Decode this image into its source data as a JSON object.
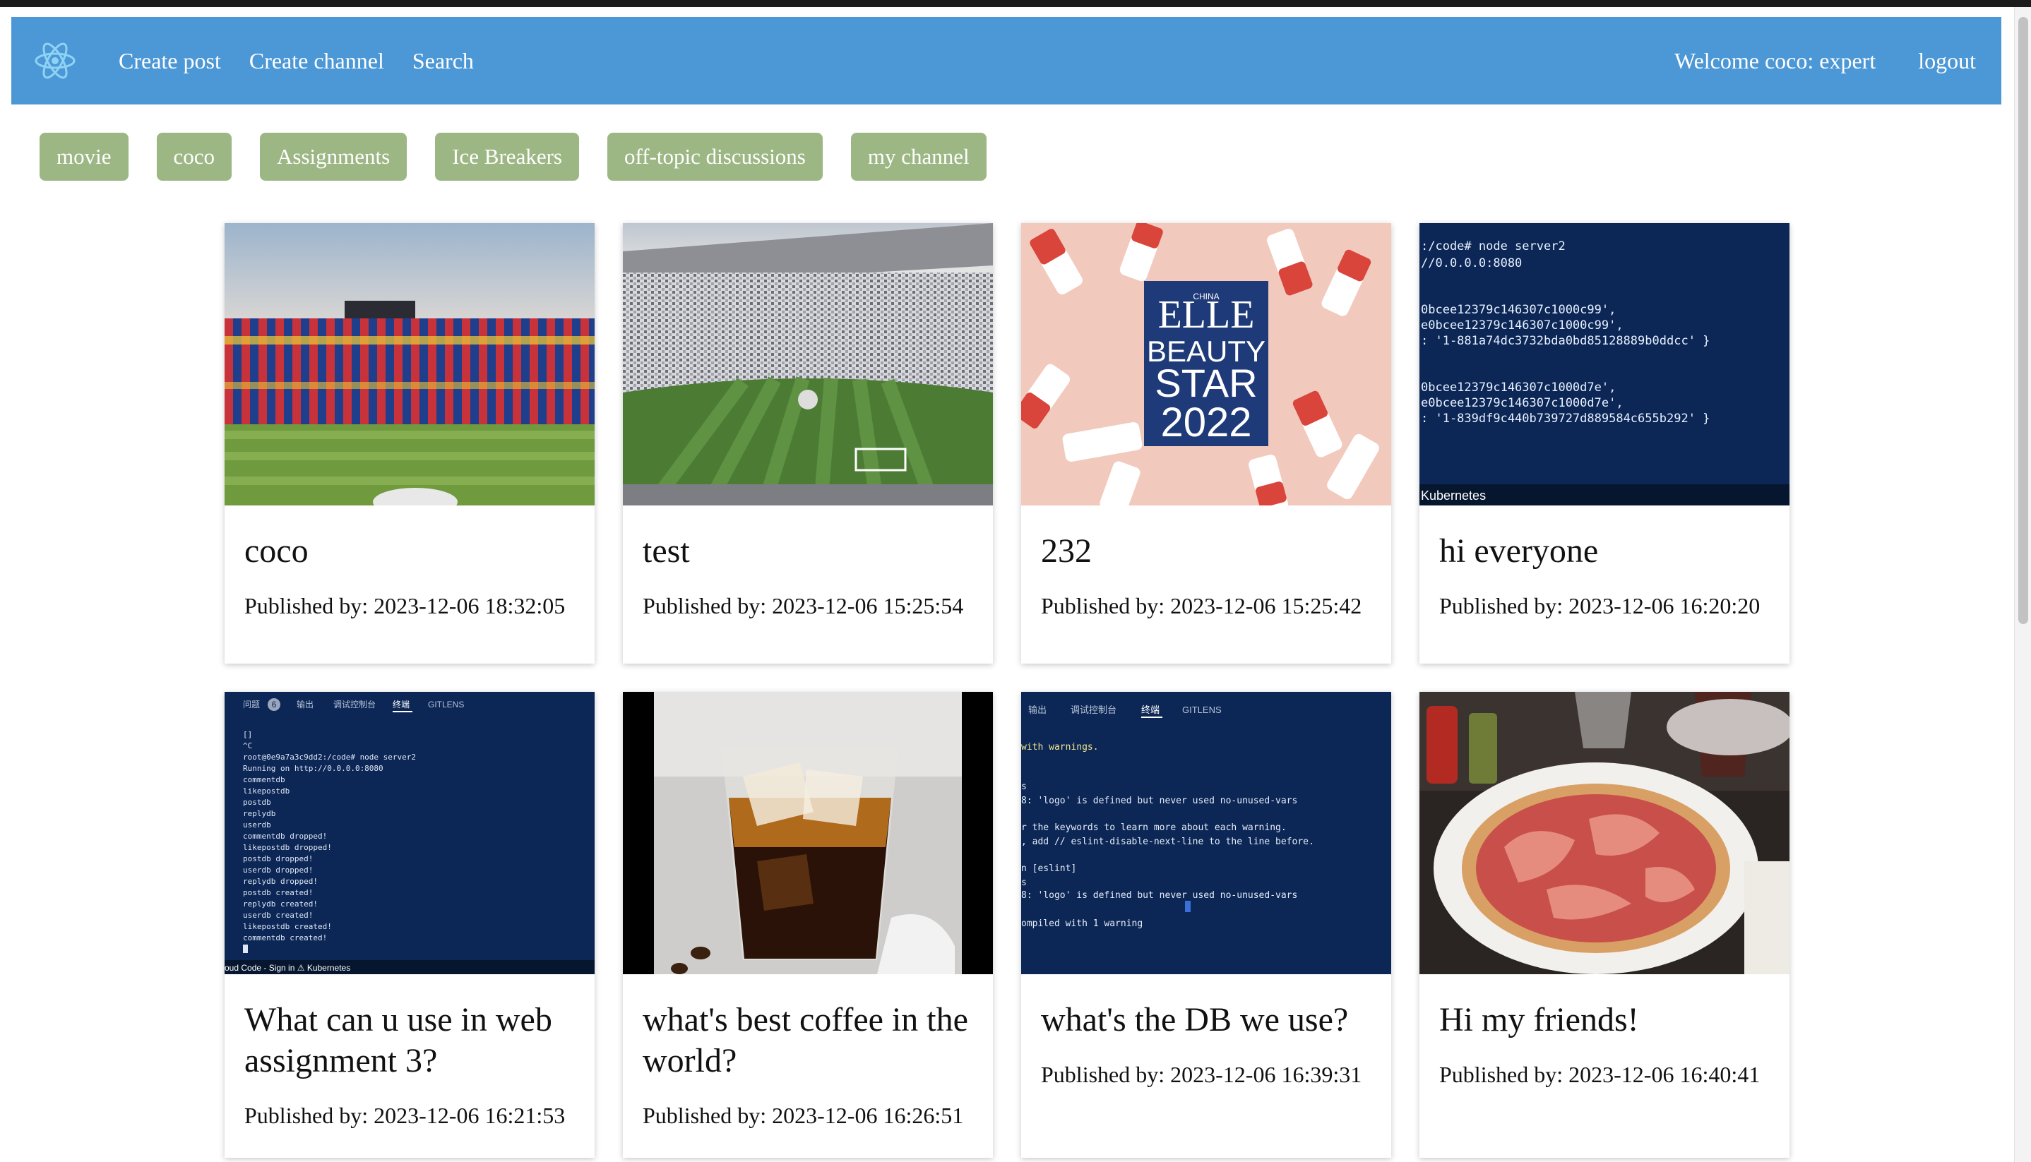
{
  "nav": {
    "links": [
      "Create post",
      "Create channel",
      "Search"
    ],
    "welcome": "Welcome coco: expert",
    "logout": "logout"
  },
  "channels": [
    "movie",
    "coco",
    "Assignments",
    "Ice Breakers",
    "off-topic discussions",
    "my channel"
  ],
  "posts": [
    {
      "title": "coco",
      "published": "Published by: 2023-12-06 18:32:05"
    },
    {
      "title": "test",
      "published": "Published by: 2023-12-06 15:25:54"
    },
    {
      "title": "232",
      "published": "Published by: 2023-12-06 15:25:42"
    },
    {
      "title": "hi everyone",
      "published": "Published by: 2023-12-06 16:20:20"
    },
    {
      "title": "What can u use in web assignment 3?",
      "published": "Published by: 2023-12-06 16:21:53"
    },
    {
      "title": "what's best coffee in the world?",
      "published": "Published by: 2023-12-06 16:26:51"
    },
    {
      "title": "what's the DB we use?",
      "published": "Published by: 2023-12-06 16:39:31"
    },
    {
      "title": "Hi my friends!",
      "published": "Published by: 2023-12-06 16:40:41"
    }
  ],
  "thumb_text": {
    "elle": {
      "brand": "ELLE",
      "line1": "BEAUTY",
      "line2": "STAR",
      "year": "2022",
      "china": "CHINA"
    },
    "terminal1": {
      "lines": [
        ":/code# node server2",
        "//0.0.0.0:8080",
        "0bcee12379c146307c1000c99',",
        "e0bcee12379c146307c1000c99',",
        ": '1-881a74dc3732bda0bd85128889b0ddcc' }",
        "0bcee12379c146307c1000d7e',",
        "e0bcee12379c146307c1000d7e',",
        ": '1-839df9c440b739727d889584c655b292' }"
      ],
      "footer": "Kubernetes"
    },
    "terminal2": {
      "tabs": [
        "问题",
        "输出",
        "调试控制台",
        "终端",
        "GITLENS"
      ],
      "badge": "6",
      "lines": [
        "[]",
        "^C",
        "root@0e9a7a3c9dd2:/code# node server2",
        "Running on http://0.0.0.0:8080",
        "commentdb",
        "likepostdb",
        "postdb",
        "replydb",
        "userdb",
        "commentdb dropped!",
        "likepostdb dropped!",
        "postdb dropped!",
        "userdb dropped!",
        "replydb dropped!",
        "postdb created!",
        "replydb created!",
        "userdb created!",
        "likepostdb created!",
        "commentdb created!"
      ],
      "footer": "oud Code - Sign in    ⚠ Kubernetes"
    },
    "terminal3": {
      "tabs": [
        "输出",
        "调试控制台",
        "终端",
        "GITLENS"
      ],
      "lines": [
        "with warnings.",
        "",
        "s",
        "8:  'logo' is defined but never used  no-unused-vars",
        "",
        "r the keywords to learn more about each warning.",
        ", add // eslint-disable-next-line to the line before.",
        "",
        "n [eslint]",
        "s",
        "8:  'logo' is defined but never used  no-unused-vars",
        "",
        "ompiled with 1 warning"
      ]
    }
  },
  "colors": {
    "navbar": "#4c97d6",
    "chip": "#9cb784",
    "terminal": "#0c2756"
  }
}
